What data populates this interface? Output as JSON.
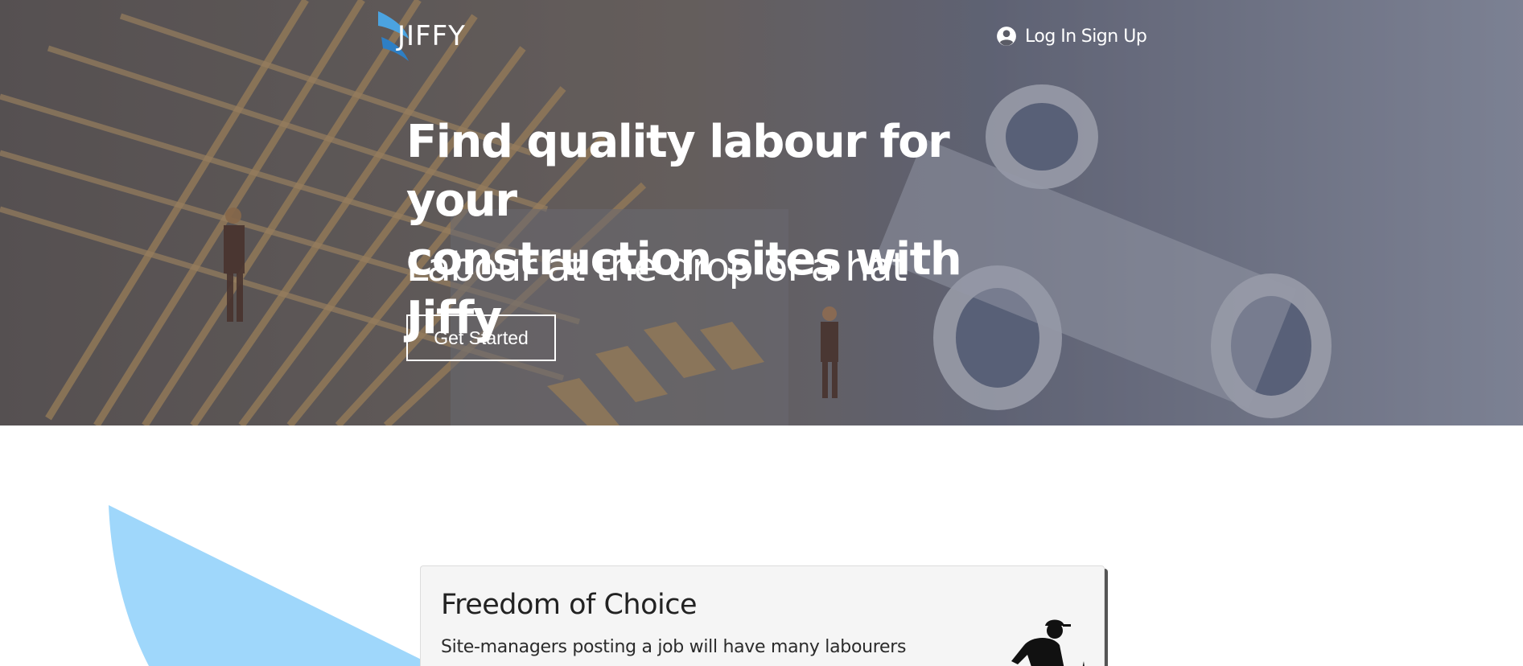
{
  "brand": {
    "logo_text": "JIFFY",
    "logo_color": "#4ba3e0"
  },
  "nav": {
    "login_label": "Log In",
    "signup_label": "Sign Up",
    "user_icon": "user-circle-icon"
  },
  "hero": {
    "title_line1": "Find quality labour for your",
    "title_line2": "construction sites with Jiffy",
    "subtitle": "Labour at the drop of a hat",
    "cta_label": "Get Started",
    "background": "construction-house-blueprints-photo"
  },
  "features": {
    "card_title": "Freedom of Choice",
    "card_text": "Site-managers posting a job will have many labourers",
    "card_icon": "construction-worker-icon",
    "accent_shape_color": "#9fd7fb"
  }
}
